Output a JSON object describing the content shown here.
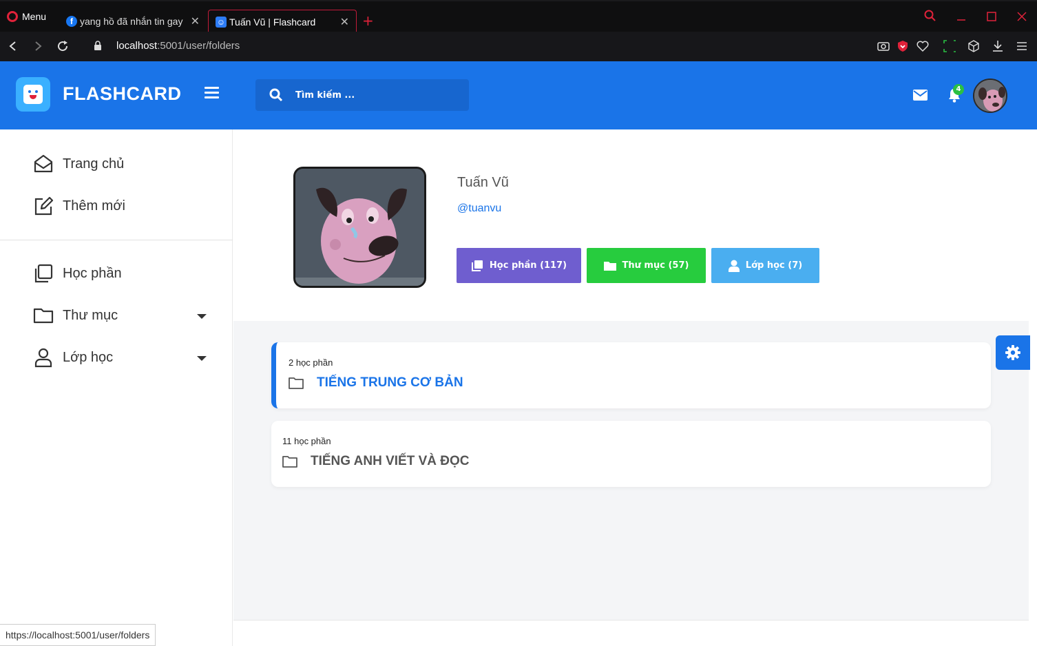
{
  "browser": {
    "menu_label": "Menu",
    "tabs": [
      {
        "title": "yang hồ đã nhắn tin gay"
      },
      {
        "title": "Tuấn Vũ | Flashcard"
      }
    ],
    "url_host": "localhost",
    "url_path": ":5001/user/folders",
    "status_url": "https://localhost:5001/user/folders"
  },
  "header": {
    "brand": "FLASHCARD",
    "search_placeholder": "Tìm kiếm ...",
    "notification_count": "4"
  },
  "sidebar": {
    "items": [
      {
        "label": "Trang chủ",
        "icon": "home-icon"
      },
      {
        "label": "Thêm mới",
        "icon": "edit-icon"
      },
      {
        "label": "Học phần",
        "icon": "copy-icon"
      },
      {
        "label": "Thư mục",
        "icon": "folder-icon"
      },
      {
        "label": "Lớp học",
        "icon": "user-icon"
      }
    ]
  },
  "profile": {
    "name": "Tuấn Vũ",
    "handle": "@tuanvu",
    "buttons": [
      {
        "label": "Học phần (117)",
        "color": "#6f5ecf"
      },
      {
        "label": "Thư mục (57)",
        "color": "#27cc3e"
      },
      {
        "label": "Lớp học (7)",
        "color": "#4aaef0"
      }
    ]
  },
  "folders": [
    {
      "count": "2 học phần",
      "title": "TIẾNG TRUNG CƠ BẢN",
      "active": true
    },
    {
      "count": "11 học phần",
      "title": "TIẾNG ANH VIẾT VÀ ĐỌC",
      "active": false
    }
  ],
  "colors": {
    "accent": "#1a74e8",
    "opera_red": "#e0223a"
  }
}
